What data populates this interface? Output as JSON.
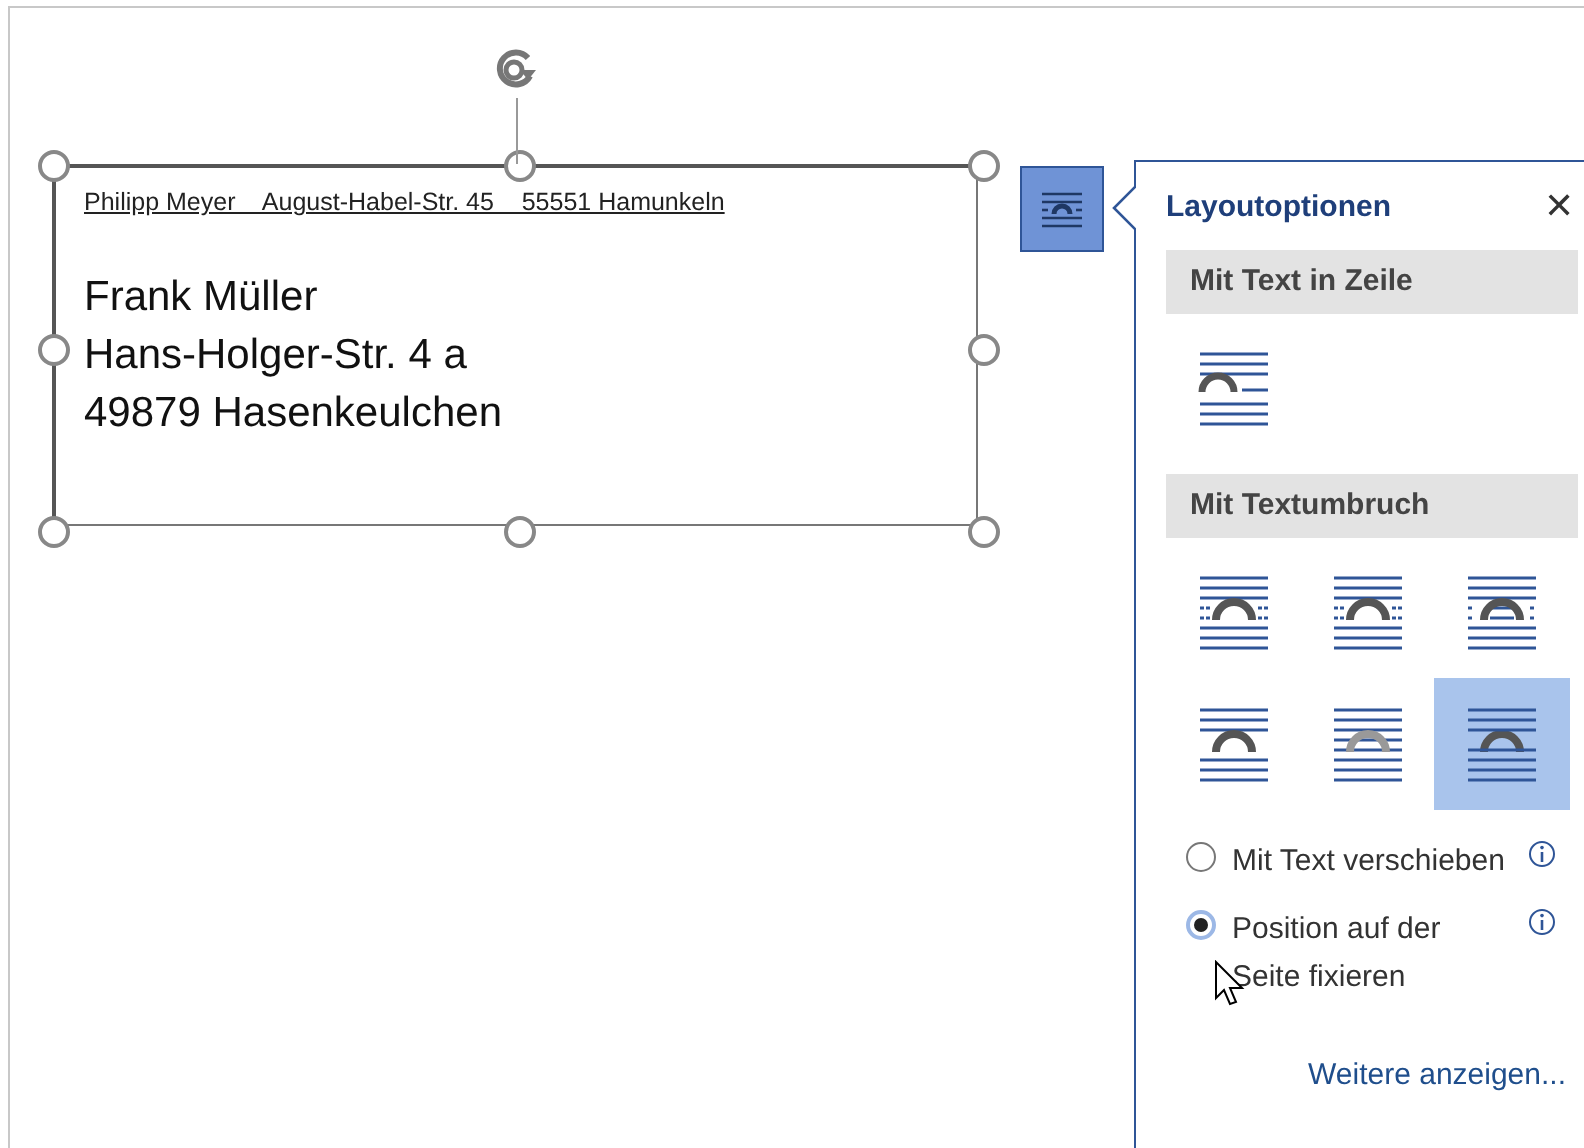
{
  "document": {
    "sender_line": "Philipp Meyer    August-Habel-Str. 45    55551 Hamunkeln",
    "address_lines": [
      "Frank Müller",
      "Hans-Holger-Str. 4 a",
      "49879 Hasenkeulchen"
    ]
  },
  "layout_button": {
    "selected": true
  },
  "panel": {
    "title": "Layoutoptionen",
    "close": "✕",
    "inline_section": {
      "heading": "Mit Text in Zeile",
      "options": [
        {
          "kind": "inline",
          "selected": false
        }
      ]
    },
    "wrap_section": {
      "heading": "Mit Textumbruch",
      "options": [
        {
          "kind": "square",
          "selected": false
        },
        {
          "kind": "tight",
          "selected": false
        },
        {
          "kind": "through",
          "selected": false
        },
        {
          "kind": "topbottom",
          "selected": false
        },
        {
          "kind": "behind",
          "selected": false
        },
        {
          "kind": "front",
          "selected": true
        }
      ]
    },
    "position_options": [
      {
        "label": "Mit Text verschieben",
        "selected": false
      },
      {
        "label": "Position auf der Seite fixieren",
        "selected": true
      }
    ],
    "more_link": "Weitere anzeigen..."
  }
}
